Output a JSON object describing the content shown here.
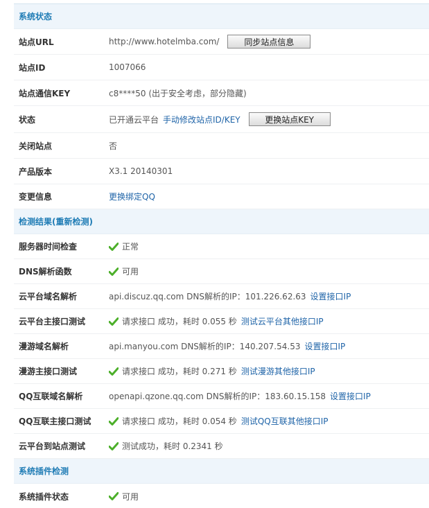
{
  "colors": {
    "accent": "#1f7cb5",
    "link": "#1f64a8",
    "check": "#4caf2a",
    "header_bg": "#eef5fb"
  },
  "system_status": {
    "title": "系统状态",
    "site_url_label": "站点URL",
    "site_url": "http://www.hotelmba.com/",
    "sync_button": "同步站点信息",
    "site_id_label": "站点ID",
    "site_id": "1007066",
    "site_key_label": "站点通信KEY",
    "site_key": "c8****50 (出于安全考虑，部分隐藏)",
    "status_label": "状态",
    "status_text": "已开通云平台",
    "manual_edit_link": "手动修改站点ID/KEY",
    "change_key_button": "更换站点KEY",
    "close_site_label": "关闭站点",
    "close_site_value": "否",
    "version_label": "产品版本",
    "version_value": "X3.1 20140301",
    "change_info_label": "变更信息",
    "change_qq_link": "更换绑定QQ"
  },
  "detection": {
    "title": "检测结果",
    "recheck_link": "(重新检测)",
    "rows": [
      {
        "label": "服务器时间检查",
        "text": "正常",
        "link": ""
      },
      {
        "label": "DNS解析函数",
        "text": "可用",
        "link": ""
      },
      {
        "label": "云平台域名解析",
        "text": "api.discuz.qq.com DNS解析的IP：101.226.62.63",
        "link": "设置接口IP"
      },
      {
        "label": "云平台主接口测试",
        "text": "请求接口 成功，耗时 0.055 秒",
        "link": "测试云平台其他接口IP"
      },
      {
        "label": "漫游域名解析",
        "text": "api.manyou.com DNS解析的IP：140.207.54.53",
        "link": "设置接口IP"
      },
      {
        "label": "漫游主接口测试",
        "text": "请求接口 成功，耗时 0.271 秒",
        "link": "测试漫游其他接口IP"
      },
      {
        "label": "QQ互联域名解析",
        "text": "openapi.qzone.qq.com DNS解析的IP：183.60.15.158",
        "link": "设置接口IP"
      },
      {
        "label": "QQ互联主接口测试",
        "text": "请求接口 成功，耗时 0.054 秒",
        "link": "测试QQ互联其他接口IP"
      },
      {
        "label": "云平台到站点测试",
        "text": "测试成功，耗时 0.2341 秒",
        "link": ""
      }
    ]
  },
  "plugins": {
    "title": "系统插件检测",
    "status_label": "系统插件状态",
    "status_text": "可用"
  },
  "icons": {
    "check": "check-icon"
  }
}
